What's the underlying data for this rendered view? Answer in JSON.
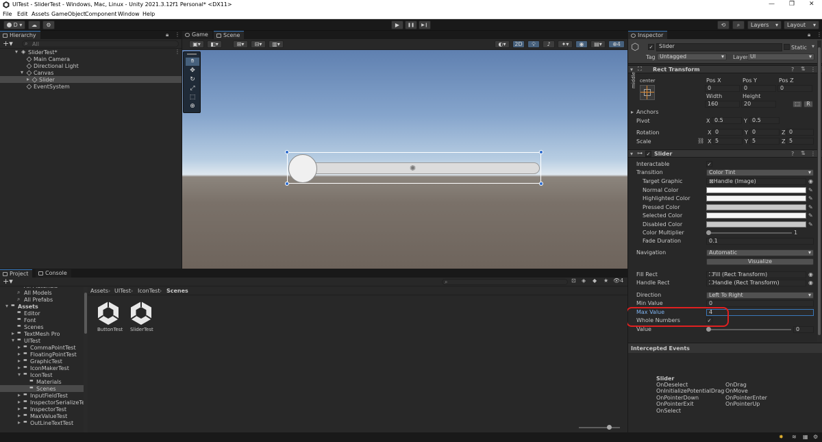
{
  "window": {
    "title": "UITest - SliderTest - Windows, Mac, Linux - Unity 2021.3.12f1 Personal* <DX11>",
    "controls": [
      "—",
      "❐",
      "✕"
    ]
  },
  "menu": [
    "File",
    "Edit",
    "Assets",
    "GameObject",
    "Component",
    "Window",
    "Help"
  ],
  "toolbar": {
    "account": "D ▾",
    "play_icon": "▶",
    "pause_icon": "❚❚",
    "step_icon": "▶❙",
    "layers": "Layers",
    "layout": "Layout"
  },
  "hierarchy": {
    "tab": "Hierarchy",
    "search_placeholder": "All",
    "items": [
      {
        "label": "SliderTest*",
        "indent": 0
      },
      {
        "label": "Main Camera",
        "indent": 1
      },
      {
        "label": "Directional Light",
        "indent": 1
      },
      {
        "label": "Canvas",
        "indent": 1
      },
      {
        "label": "Slider",
        "indent": 2
      },
      {
        "label": "EventSystem",
        "indent": 1
      }
    ]
  },
  "scene": {
    "tabs": [
      "Game",
      "Scene"
    ],
    "mode_2d": "2D",
    "gizmo_count": "4"
  },
  "inspector": {
    "tab": "Inspector",
    "object_name": "Slider",
    "static_label": "Static",
    "tag_label": "Tag",
    "tag_value": "Untagged",
    "layer_label": "Layer",
    "layer_value": "UI",
    "rect_transform": {
      "title": "Rect Transform",
      "anchor_preset_top": "center",
      "anchor_preset_side": "middle",
      "pos_x_label": "Pos X",
      "pos_y_label": "Pos Y",
      "pos_z_label": "Pos Z",
      "pos_x": "0",
      "pos_y": "0",
      "pos_z": "0",
      "width_label": "Width",
      "height_label": "Height",
      "width": "160",
      "height": "20",
      "r_button": "R",
      "anchors_label": "Anchors",
      "pivot_label": "Pivot",
      "pivot_x": "0.5",
      "pivot_y": "0.5",
      "rotation_label": "Rotation",
      "rot_x": "0",
      "rot_y": "0",
      "rot_z": "0",
      "scale_label": "Scale",
      "scale_x": "5",
      "scale_y": "5",
      "scale_z": "5",
      "x": "X",
      "y": "Y",
      "z": "Z"
    },
    "slider": {
      "title": "Slider",
      "interactable_label": "Interactable",
      "transition_label": "Transition",
      "transition_value": "Color Tint",
      "target_graphic_label": "Target Graphic",
      "target_graphic_value": "Handle (Image)",
      "normal_color_label": "Normal Color",
      "highlighted_color_label": "Highlighted Color",
      "pressed_color_label": "Pressed Color",
      "selected_color_label": "Selected Color",
      "disabled_color_label": "Disabled Color",
      "color_multiplier_label": "Color Multiplier",
      "color_multiplier_value": "1",
      "fade_duration_label": "Fade Duration",
      "fade_duration_value": "0.1",
      "navigation_label": "Navigation",
      "navigation_value": "Automatic",
      "visualize_label": "Visualize",
      "fill_rect_label": "Fill Rect",
      "fill_rect_value": "Fill (Rect Transform)",
      "handle_rect_label": "Handle Rect",
      "handle_rect_value": "Handle (Rect Transform)",
      "direction_label": "Direction",
      "direction_value": "Left To Right",
      "min_value_label": "Min Value",
      "min_value": "0",
      "max_value_label": "Max Value",
      "max_value": "4",
      "whole_numbers_label": "Whole Numbers",
      "value_label": "Value",
      "value": "0"
    },
    "colors": {
      "normal": "#ffffff",
      "highlighted": "#f5f5f5",
      "pressed": "#c8c8c8",
      "selected": "#f5f5f5",
      "disabled": "#c8c8c8"
    }
  },
  "events": {
    "title": "Intercepted Events",
    "group": "Slider",
    "col1": [
      "OnDeselect",
      "OnInitializePotentialDrag",
      "OnPointerDown",
      "OnPointerExit",
      "OnSelect"
    ],
    "col2": [
      "OnDrag",
      "OnMove",
      "OnPointerEnter",
      "OnPointerUp"
    ]
  },
  "project": {
    "tabs": [
      "Project",
      "Console"
    ],
    "tree": [
      {
        "label": "All Materials",
        "indent": 1,
        "type": "search"
      },
      {
        "label": "All Models",
        "indent": 1,
        "type": "search"
      },
      {
        "label": "All Prefabs",
        "indent": 1,
        "type": "search"
      },
      {
        "label": "Assets",
        "indent": 0,
        "type": "folder",
        "bold": true
      },
      {
        "label": "Editor",
        "indent": 1,
        "type": "folder"
      },
      {
        "label": "Font",
        "indent": 1,
        "type": "folder"
      },
      {
        "label": "Scenes",
        "indent": 1,
        "type": "folder"
      },
      {
        "label": "TextMesh Pro",
        "indent": 1,
        "type": "folder"
      },
      {
        "label": "UITest",
        "indent": 1,
        "type": "folder"
      },
      {
        "label": "CommaPointTest",
        "indent": 2,
        "type": "folder"
      },
      {
        "label": "FloatingPointTest",
        "indent": 2,
        "type": "folder"
      },
      {
        "label": "GraphicTest",
        "indent": 2,
        "type": "folder"
      },
      {
        "label": "IconMakerTest",
        "indent": 2,
        "type": "folder"
      },
      {
        "label": "IconTest",
        "indent": 2,
        "type": "folder"
      },
      {
        "label": "Materials",
        "indent": 3,
        "type": "folder"
      },
      {
        "label": "Scenes",
        "indent": 3,
        "type": "folder",
        "selected": true
      },
      {
        "label": "InputFieldTest",
        "indent": 2,
        "type": "folder"
      },
      {
        "label": "InspectorSerializeTest",
        "indent": 2,
        "type": "folder"
      },
      {
        "label": "InspectorTest",
        "indent": 2,
        "type": "folder"
      },
      {
        "label": "MaxValueTest",
        "indent": 2,
        "type": "folder"
      },
      {
        "label": "OutLineTextTest",
        "indent": 2,
        "type": "folder"
      }
    ],
    "breadcrumb": [
      "Assets",
      "UITest",
      "IconTest",
      "Scenes"
    ],
    "assets": [
      {
        "label": "ButtonTest"
      },
      {
        "label": "SliderTest"
      }
    ],
    "hidden_count": "4"
  },
  "accent": {
    "selection": "#3a79bb",
    "highlight_ring": "#e02020"
  }
}
